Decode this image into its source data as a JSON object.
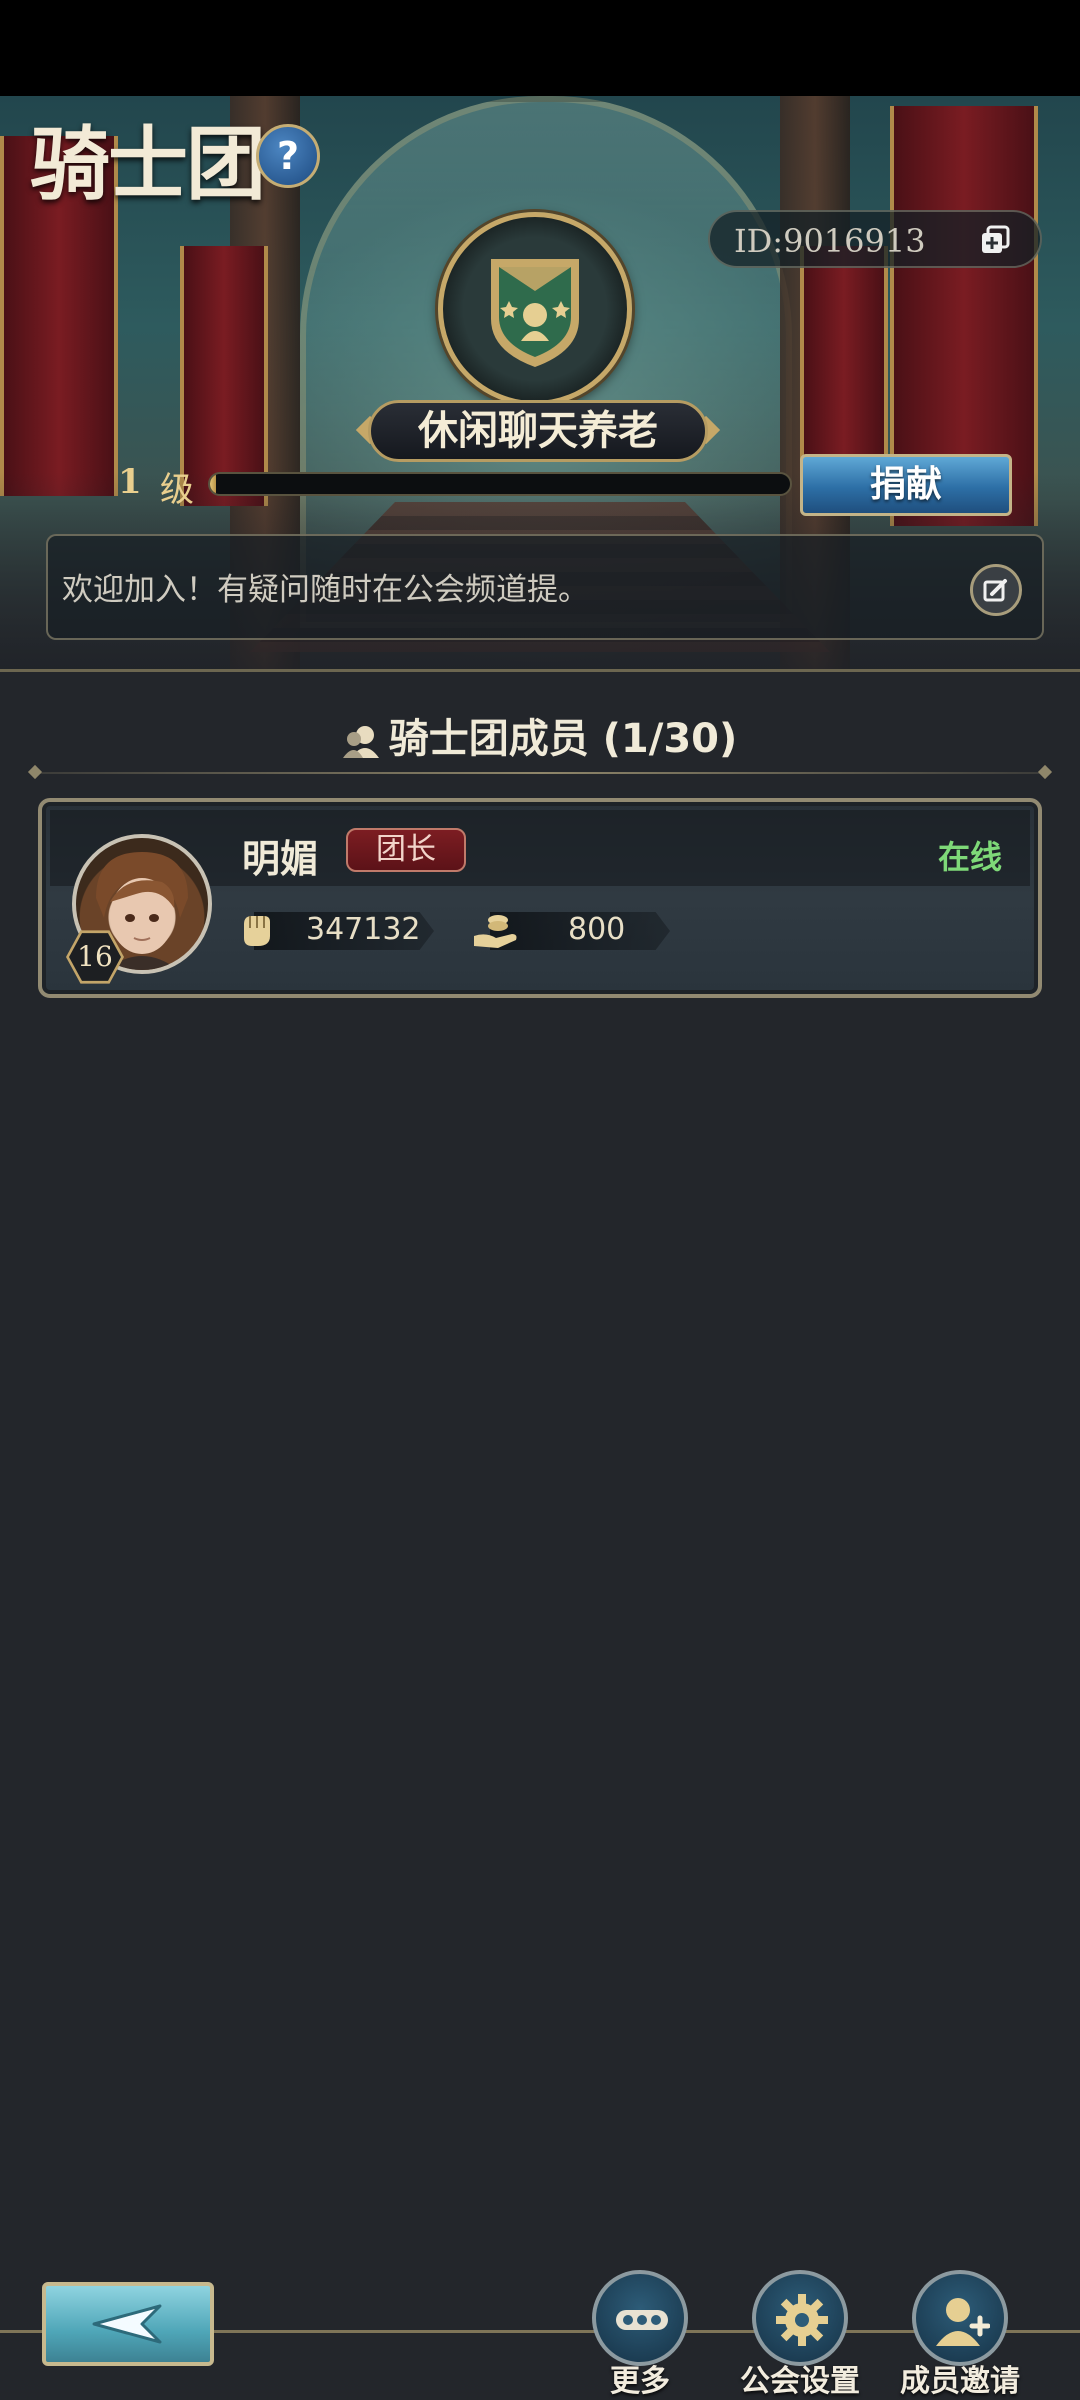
{
  "header": {
    "title": "骑士团",
    "help_label": "?",
    "guild_id": "ID:9016913",
    "guild_name": "休闲聊天养老",
    "level_number": "1",
    "level_unit": "级",
    "level_progress": 0.01,
    "donate_label": "捐献",
    "announcement": "欢迎加入！有疑问随时在公会频道提。"
  },
  "members_section": {
    "title": "骑士团成员 (1/30)"
  },
  "members": [
    {
      "name": "明媚",
      "role": "团长",
      "status": "在线",
      "level": "16",
      "power": "347132",
      "contribution": "800"
    }
  ],
  "bottom_nav": {
    "back_icon": "back-arrow-icon",
    "items": [
      {
        "label": "更多",
        "icon": "more-icon"
      },
      {
        "label": "公会设置",
        "icon": "gear-icon"
      },
      {
        "label": "成员邀请",
        "icon": "invite-member-icon"
      }
    ]
  },
  "colors": {
    "gold": "#c6a868",
    "online": "#7ed978",
    "role_badge": "#7c1d22",
    "donate_button": "#2d6fa6"
  }
}
